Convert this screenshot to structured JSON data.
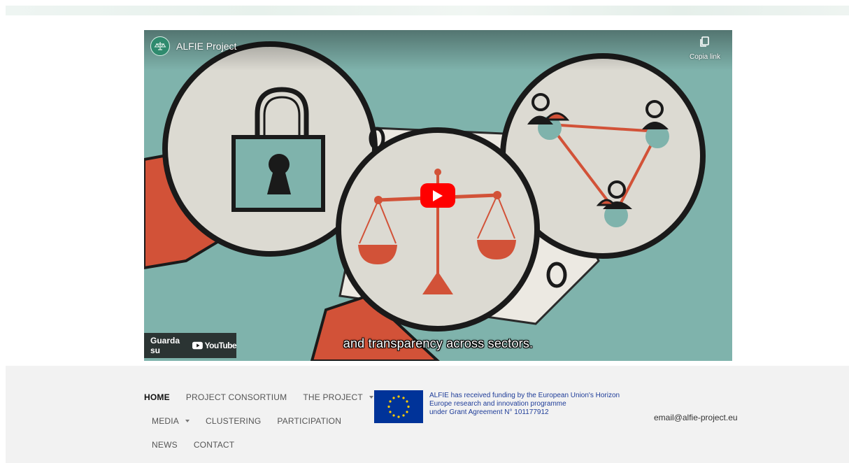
{
  "video": {
    "channel_title": "ALFIE Project",
    "copy_link_label": "Copia link",
    "watch_on_label": "Guarda su",
    "youtube_wordmark": "YouTube",
    "caption": "and transparency across sectors.",
    "icons": {
      "play": "play-icon",
      "copy": "copy-icon",
      "youtube": "youtube-logo-icon"
    }
  },
  "footer": {
    "nav": [
      {
        "label": "HOME",
        "active": true
      },
      {
        "label": "PROJECT CONSORTIUM"
      },
      {
        "label": "THE PROJECT",
        "dropdown": true
      },
      {
        "label": "MEDIA",
        "dropdown": true
      },
      {
        "label": "CLUSTERING"
      },
      {
        "label": "PARTICIPATION"
      },
      {
        "label": "NEWS"
      },
      {
        "label": "CONTACT"
      }
    ],
    "funding_lines": [
      "ALFIE has received funding by the European Union's Horizon",
      "Europe research and innovation programme",
      "under Grant Agreement N° 101177912"
    ],
    "email": "email@alfie-project.eu"
  },
  "colors": {
    "youtube_red": "#ff0000",
    "footer_bg": "#f2f2f2",
    "eu_blue": "#003399",
    "eu_star": "#ffcc00",
    "funding_text": "#1f3d99",
    "video_bg": "#7fb3ac"
  }
}
